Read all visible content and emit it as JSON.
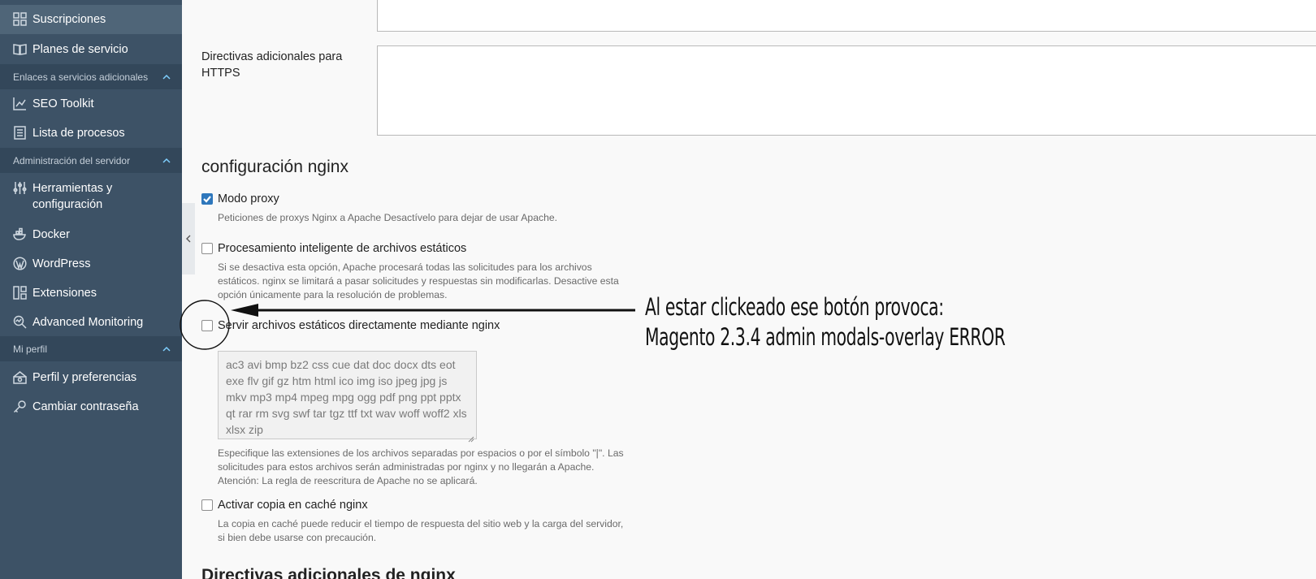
{
  "sidebar": {
    "items": [
      {
        "label": "Suscripciones",
        "icon": "grid-icon"
      },
      {
        "label": "Planes de servicio",
        "icon": "book-icon"
      },
      {
        "label": "SEO Toolkit",
        "icon": "chart-icon"
      },
      {
        "label": "Lista de procesos",
        "icon": "list-icon"
      },
      {
        "label": "Herramientas y configuración",
        "icon": "sliders-icon"
      },
      {
        "label": "Docker",
        "icon": "docker-icon"
      },
      {
        "label": "WordPress",
        "icon": "wordpress-icon"
      },
      {
        "label": "Extensiones",
        "icon": "extensions-icon"
      },
      {
        "label": "Advanced Monitoring",
        "icon": "monitoring-icon"
      },
      {
        "label": "Perfil y preferencias",
        "icon": "profile-icon"
      },
      {
        "label": "Cambiar contraseña",
        "icon": "key-icon"
      }
    ],
    "sections": [
      {
        "label": "Enlaces a servicios adicionales"
      },
      {
        "label": "Administración del servidor"
      },
      {
        "label": "Mi perfil"
      }
    ]
  },
  "main": {
    "https_label": "Directivas adicionales para HTTPS",
    "nginx_title": "configuración nginx",
    "next_title": "Directivas adicionales de nginx",
    "options": [
      {
        "label": "Modo proxy",
        "checked": true,
        "hint": "Peticiones de proxys Nginx a Apache Desactívelo para dejar de usar Apache."
      },
      {
        "label": "Procesamiento inteligente de archivos estáticos",
        "checked": false,
        "hint": "Si se desactiva esta opción, Apache procesará todas las solicitudes para los archivos estáticos. nginx se limitará a pasar solicitudes y respuestas sin modificarlas. Desactive esta opción únicamente para la resolución de problemas."
      },
      {
        "label": "Servir archivos estáticos directamente mediante nginx",
        "checked": false,
        "hint": "Especifique las extensiones de los archivos separadas por espacios o por el símbolo \"|\". Las solicitudes para estos archivos serán administradas por nginx y no llegarán a Apache. Atención: La regla de reescritura de Apache no se aplicará."
      },
      {
        "label": "Activar copia en caché nginx",
        "checked": false,
        "hint": "La copia en caché puede reducir el tiempo de respuesta del sitio web y la carga del servidor, si bien debe usarse con precaución."
      }
    ],
    "extensions_value": "ac3 avi bmp bz2 css cue dat doc docx dts eot exe flv gif gz htm html ico img iso jpeg jpg js mkv mp3 mp4 mpeg mpg ogg pdf png ppt pptx qt rar rm svg swf tar tgz ttf txt wav woff woff2 xls xlsx zip"
  },
  "annotation": {
    "line1": "Al estar clickeado ese botón provoca:",
    "line2": "Magento 2.3.4 admin modals-overlay ERROR"
  }
}
